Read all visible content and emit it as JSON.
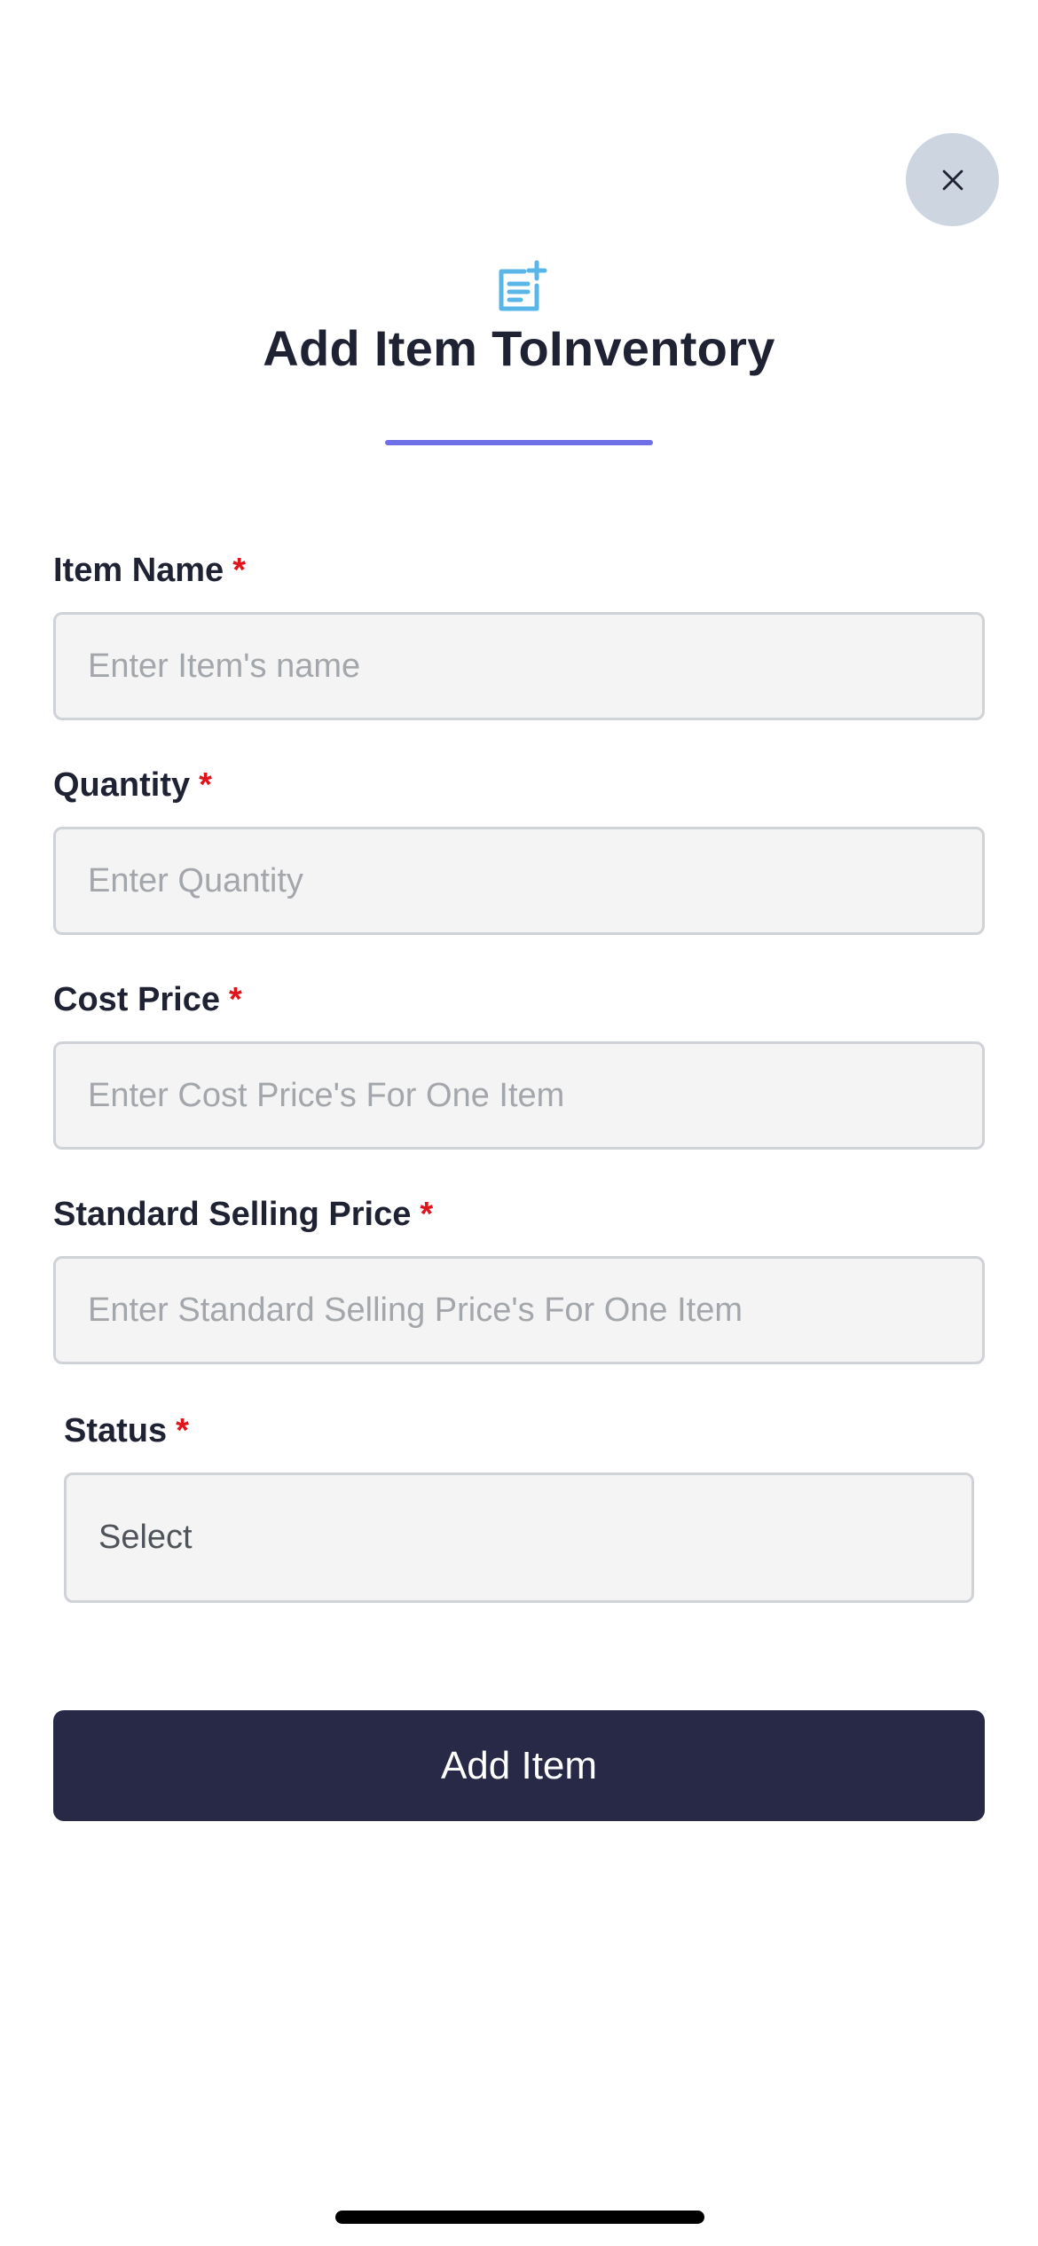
{
  "header": {
    "title": "Add Item ToInventory",
    "icon": "note-add-icon",
    "close_icon": "close-icon"
  },
  "form": {
    "fields": [
      {
        "label": "Item Name",
        "required_mark": "*",
        "placeholder": "Enter Item's name",
        "value": ""
      },
      {
        "label": "Quantity",
        "required_mark": "*",
        "placeholder": "Enter Quantity",
        "value": ""
      },
      {
        "label": "Cost Price",
        "required_mark": "*",
        "placeholder": "Enter Cost Price's For One Item",
        "value": ""
      },
      {
        "label": "Standard Selling Price",
        "required_mark": "*",
        "placeholder": "Enter Standard Selling Price's For One Item",
        "value": ""
      }
    ],
    "status": {
      "label": "Status",
      "required_mark": "*",
      "selected": "Select"
    },
    "submit_label": "Add Item"
  },
  "colors": {
    "accent_underline": "#6f70e8",
    "icon": "#5bb6e8",
    "button_bg": "#272946",
    "required": "#e0141b"
  }
}
